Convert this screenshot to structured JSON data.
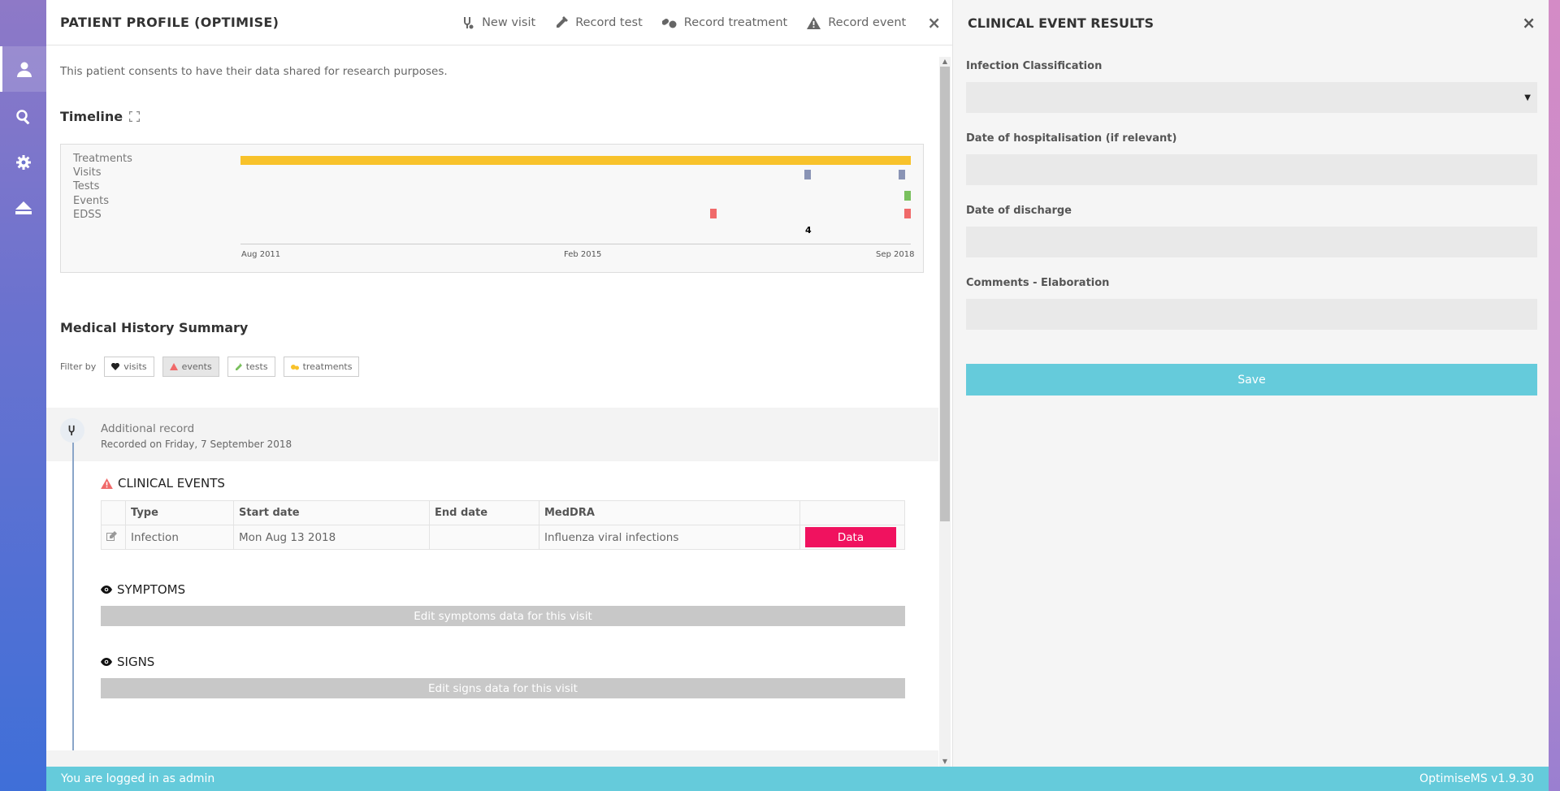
{
  "sidebar": {
    "items": [
      {
        "icon": "user-icon",
        "active": true
      },
      {
        "icon": "search-icon",
        "active": false
      },
      {
        "icon": "gear-icon",
        "active": false
      },
      {
        "icon": "eject-icon",
        "active": false
      }
    ]
  },
  "header": {
    "title": "PATIENT PROFILE (OPTIMISE)",
    "actions": {
      "new_visit": "New visit",
      "record_test": "Record test",
      "record_treatment": "Record treatment",
      "record_event": "Record event"
    },
    "close": "×"
  },
  "consent_text": "This patient consents to have their data shared for research purposes.",
  "timeline": {
    "heading": "Timeline",
    "rows": [
      "Treatments",
      "Visits",
      "Tests",
      "Events",
      "EDSS"
    ],
    "ticks": [
      "Aug 2011",
      "Feb 2015",
      "Sep 2018"
    ],
    "edss_value": "4",
    "colors": {
      "treatments": "#f8c22b",
      "visits": "#8a94b5",
      "tests": "#79c05d",
      "events": "#f06a6a"
    }
  },
  "medical_history": {
    "heading": "Medical History Summary",
    "filter_label": "Filter by",
    "filters": {
      "visits": "visits",
      "events": "events",
      "tests": "tests",
      "treatments": "treatments"
    },
    "active_filter": "events"
  },
  "record": {
    "title": "Additional record",
    "subtitle": "Recorded on Friday, 7 September 2018"
  },
  "clinical_events": {
    "title": "CLINICAL EVENTS",
    "columns": [
      "Type",
      "Start date",
      "End date",
      "MedDRA"
    ],
    "rows": [
      {
        "type": "Infection",
        "start": "Mon Aug 13 2018",
        "end": "",
        "meddra": "Influenza viral infections",
        "button": "Data"
      }
    ]
  },
  "symptoms": {
    "title": "SYMPTOMS",
    "button": "Edit symptoms data for this visit"
  },
  "signs": {
    "title": "SIGNS",
    "button": "Edit signs data for this visit"
  },
  "results_panel": {
    "title": "CLINICAL EVENT RESULTS",
    "close": "×",
    "fields": {
      "infection_classification": "Infection Classification",
      "date_hospitalisation": "Date of hospitalisation (if relevant)",
      "date_discharge": "Date of discharge",
      "comments": "Comments - Elaboration"
    },
    "save": "Save"
  },
  "footer": {
    "login_text": "You are logged in as admin",
    "version": "OptimiseMS v1.9.30"
  },
  "colors": {
    "accent": "#65cbdb",
    "data_button": "#f0125f"
  }
}
